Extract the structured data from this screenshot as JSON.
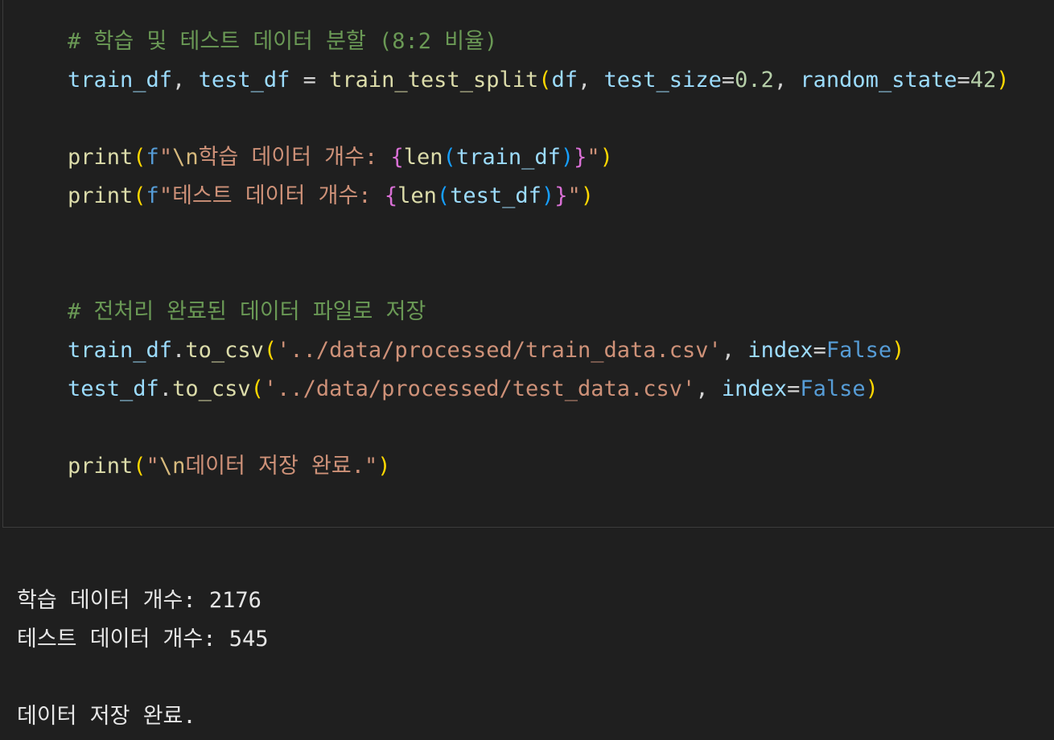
{
  "code": {
    "line1": [
      "# 학습 및 테스트 데이터 분할 (8:2 비율)"
    ],
    "line2": [
      "train_df",
      ", ",
      "test_df",
      " = ",
      "train_test_split",
      "(",
      "df",
      ", ",
      "test_size",
      "=",
      "0.2",
      ", ",
      "random_state",
      "=",
      "42",
      ")"
    ],
    "line3": [
      "print",
      "(",
      "f",
      "\"",
      "\\n",
      "학습 데이터 개수: ",
      "{",
      "len",
      "(",
      "train_df",
      ")",
      "}",
      "\"",
      ")"
    ],
    "line4": [
      "print",
      "(",
      "f",
      "\"테스트 데이터 개수: ",
      "{",
      "len",
      "(",
      "test_df",
      ")",
      "}",
      "\"",
      ")"
    ],
    "line5": [
      "# 전처리 완료된 데이터 파일로 저장"
    ],
    "line6": [
      "train_df",
      ".",
      "to_csv",
      "(",
      "'../data/processed/train_data.csv'",
      ", ",
      "index",
      "=",
      "False",
      ")"
    ],
    "line7": [
      "test_df",
      ".",
      "to_csv",
      "(",
      "'../data/processed/test_data.csv'",
      ", ",
      "index",
      "=",
      "False",
      ")"
    ],
    "line8": [
      "print",
      "(",
      "\"",
      "\\n",
      "데이터 저장 완료.\"",
      ")"
    ]
  },
  "output": {
    "line1": "학습 데이터 개수: 2176",
    "line2": "테스트 데이터 개수: 545",
    "line3": "데이터 저장 완료."
  },
  "theme": {
    "background": "#1f1f1f",
    "comment": "#6a9955",
    "variable": "#9cdcfe",
    "function": "#dcdcaa",
    "number": "#b5cea8",
    "string": "#ce9178",
    "keyword": "#569cd6",
    "bracket_level1": "#ffd700",
    "bracket_level2": "#da70d6",
    "bracket_level3": "#179fff"
  }
}
